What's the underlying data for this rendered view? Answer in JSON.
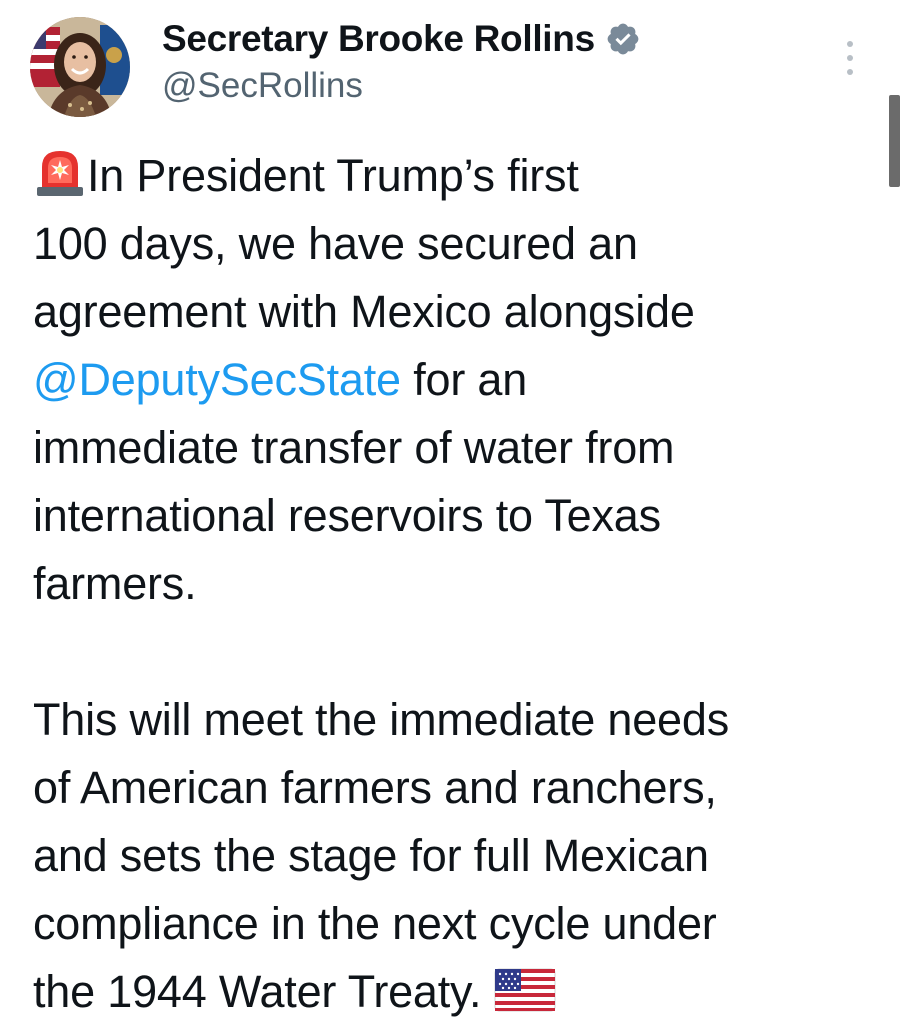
{
  "author": {
    "display_name": "Secretary Brooke Rollins",
    "handle": "@SecRollins",
    "verified": true,
    "verified_color": "#7a8a99"
  },
  "icons": {
    "verified": "verified-badge-icon",
    "more": "more-options-icon",
    "siren_emoji": "police-car-light-emoji",
    "flag_emoji": "us-flag-emoji"
  },
  "tweet": {
    "p1_line1": "In President Trump’s first",
    "p1_line2": "100 days, we have secured an",
    "p1_line3": "agreement with Mexico alongside",
    "p1_mention": "@DeputySecState",
    "p1_line4_rest": " for an",
    "p1_line5": "immediate transfer of water from",
    "p1_line6": "international reservoirs to Texas",
    "p1_line7": "farmers.",
    "p2_line1": "This will meet the immediate needs",
    "p2_line2": "of American farmers and ranchers,",
    "p2_line3": "and sets the stage for full Mexican",
    "p2_line4": "compliance in the next cycle under",
    "p2_line5": "the 1944 Water Treaty. "
  },
  "colors": {
    "text": "#0f1419",
    "secondary": "#536471",
    "link": "#1d9bf0"
  }
}
